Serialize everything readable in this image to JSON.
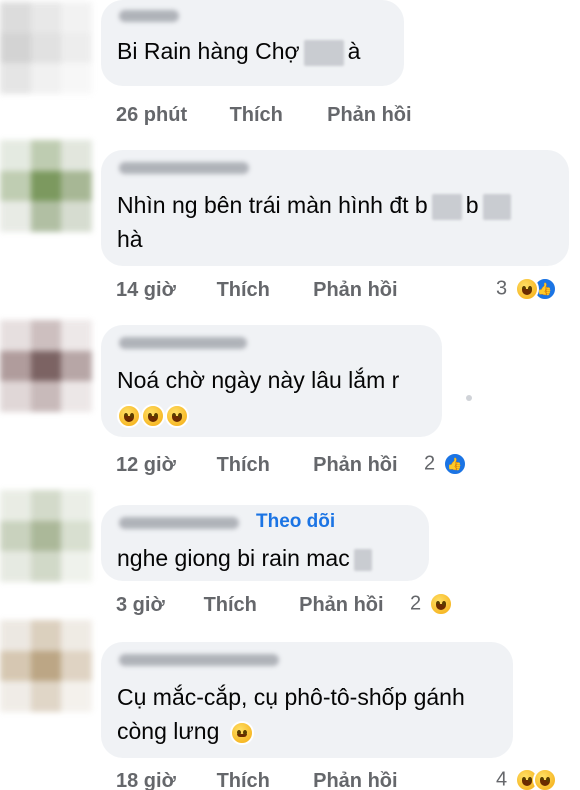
{
  "comments": [
    {
      "text_parts": [
        "Bi Rain hàng  Chợ",
        "à"
      ],
      "time": "26 phút",
      "like": "Thích",
      "reply": "Phản hồi",
      "reaction_count": ""
    },
    {
      "text_line1_parts": [
        "Nhìn ng bên trái màn hình đt b",
        "b"
      ],
      "text_line2": "hà",
      "time": "14 giờ",
      "like": "Thích",
      "reply": "Phản hồi",
      "reaction_count": "3"
    },
    {
      "text_line1": "Noá chờ ngày này lâu lắm r",
      "emoji_line": "🤣🤣🤣",
      "time": "12 giờ",
      "like": "Thích",
      "reply": "Phản hồi",
      "reaction_count": "2"
    },
    {
      "follow": "Theo dõi",
      "text_parts": [
        "nghe giong bi rain  mac",
        ""
      ],
      "time": "3 giờ",
      "like": "Thích",
      "reply": "Phản hồi",
      "reaction_count": "2"
    },
    {
      "text_line1": "Cụ mắc-cắp, cụ phô-tô-shốp gánh",
      "text_line2": "còng lưng",
      "time": "18 giờ",
      "like": "Thích",
      "reply": "Phản hồi",
      "reaction_count": "4"
    }
  ],
  "icons": {
    "reaction_haha": "haha-emoji-icon",
    "reaction_like": "like-icon",
    "reaction_relieved": "relieved-emoji-icon"
  },
  "colors": {
    "bubble": "#f0f2f5",
    "meta": "#65676b",
    "link": "#1b74e4"
  }
}
